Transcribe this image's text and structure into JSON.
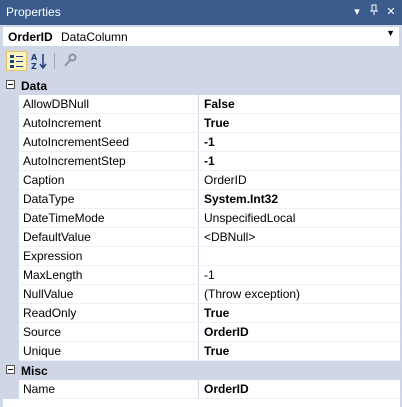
{
  "window": {
    "title": "Properties"
  },
  "object_selector": {
    "name": "OrderID",
    "type": "DataColumn"
  },
  "toolbar": {
    "categorized_icon": "categorized-icon",
    "alphabetical_icon": "alphabetical-icon",
    "property_pages_icon": "wrench-icon"
  },
  "grid": {
    "categories": [
      {
        "label": "Data",
        "properties": [
          {
            "name": "AllowDBNull",
            "value": "False",
            "bold": true
          },
          {
            "name": "AutoIncrement",
            "value": "True",
            "bold": true
          },
          {
            "name": "AutoIncrementSeed",
            "value": "-1",
            "bold": true
          },
          {
            "name": "AutoIncrementStep",
            "value": "-1",
            "bold": true
          },
          {
            "name": "Caption",
            "value": "OrderID",
            "bold": false
          },
          {
            "name": "DataType",
            "value": "System.Int32",
            "bold": true
          },
          {
            "name": "DateTimeMode",
            "value": "UnspecifiedLocal",
            "bold": false
          },
          {
            "name": "DefaultValue",
            "value": "<DBNull>",
            "bold": false
          },
          {
            "name": "Expression",
            "value": "",
            "bold": false
          },
          {
            "name": "MaxLength",
            "value": "-1",
            "bold": false
          },
          {
            "name": "NullValue",
            "value": "(Throw exception)",
            "bold": false
          },
          {
            "name": "ReadOnly",
            "value": "True",
            "bold": true
          },
          {
            "name": "Source",
            "value": "OrderID",
            "bold": true
          },
          {
            "name": "Unique",
            "value": "True",
            "bold": true
          }
        ]
      },
      {
        "label": "Misc",
        "properties": [
          {
            "name": "Name",
            "value": "OrderID",
            "bold": true
          }
        ]
      }
    ]
  },
  "colors": {
    "title_bar": "#3a5b8c",
    "chrome": "#cfd6e5",
    "active_button": "#fdf4bf"
  }
}
